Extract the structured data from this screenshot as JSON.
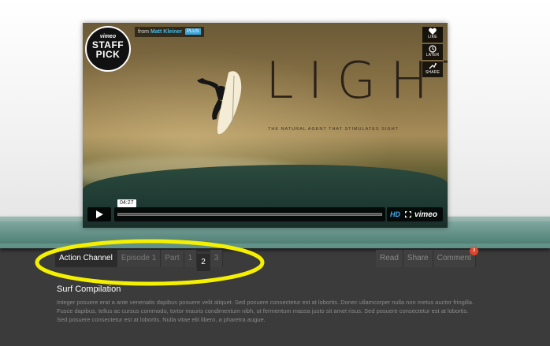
{
  "video": {
    "from_label": "from",
    "author": "Matt Kleiner",
    "plus_badge": "PLUS",
    "staff_pick": {
      "brand": "vimeo",
      "line1": "STAFF",
      "line2": "PICK"
    },
    "side_buttons": [
      {
        "label": "LIKE",
        "icon": "heart-icon"
      },
      {
        "label": "LATER",
        "icon": "clock-icon"
      },
      {
        "label": "SHARE",
        "icon": "share-icon"
      }
    ],
    "title_art": "LIGHT",
    "subtitle_art": "THE NATURAL AGENT THAT STIMULATES SIGHT",
    "time": "04:27",
    "hd_label": "HD",
    "brand_logo": "vimeo",
    "progress_fraction": 0.0
  },
  "tabs": {
    "channel": "Action Channel",
    "items": [
      "Episode 1",
      "Part",
      "1",
      "2",
      "3"
    ],
    "active_index": 3
  },
  "actions": {
    "read": "Read",
    "share": "Share",
    "comment": "Comment",
    "comment_count": "3"
  },
  "description": {
    "title": "Surf Compilation",
    "body": "Integer posuere erat a ante venenatis dapibus posuere velit aliquet. Sed posuere consectetur est at lobortis. Donec ullamcorper nulla non metus auctor fringilla. Fusce dapibus, tellus ac cursus commodo, tortor mauris condimentum nibh, ut fermentum massa justo sit amet risus. Sed posuere consectetur est at lobortis. Sed posuere consectetur est at lobortis. Nulla vitae elit libero, a pharetra augue."
  },
  "colors": {
    "highlight": "#f5f000",
    "accent": "#44bbee",
    "badge": "#e0452b"
  }
}
